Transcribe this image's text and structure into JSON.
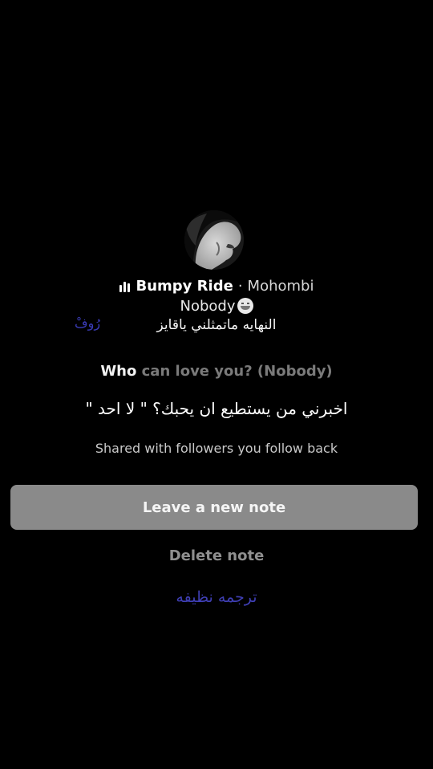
{
  "profile": {
    "avatar_icon": "profile-photo"
  },
  "music": {
    "icon": "audio-bars-icon",
    "title": "Bumpy Ride",
    "separator": "·",
    "artist": "Mohombi"
  },
  "note": {
    "text": "Nobody",
    "emoji": "grinning-sweat-emoji"
  },
  "overlay": {
    "arabic_subtitle": "النهايه ماتمثلني ياقايز",
    "signature": "رُوفْ",
    "arabic_translation": "اخبرني من يستطيع ان يحبك؟ \" لا احد \"",
    "clean_translation": "ترجمه نظيفه"
  },
  "question": {
    "who": "Who",
    "rest": " can love you? (Nobody)"
  },
  "shared_text": "Shared with followers you follow back",
  "actions": {
    "leave_note": "Leave a new note",
    "delete_note": "Delete note"
  },
  "colors": {
    "background": "#000000",
    "button": "#8a8a8a",
    "accent_blue": "#3f3fb5"
  }
}
